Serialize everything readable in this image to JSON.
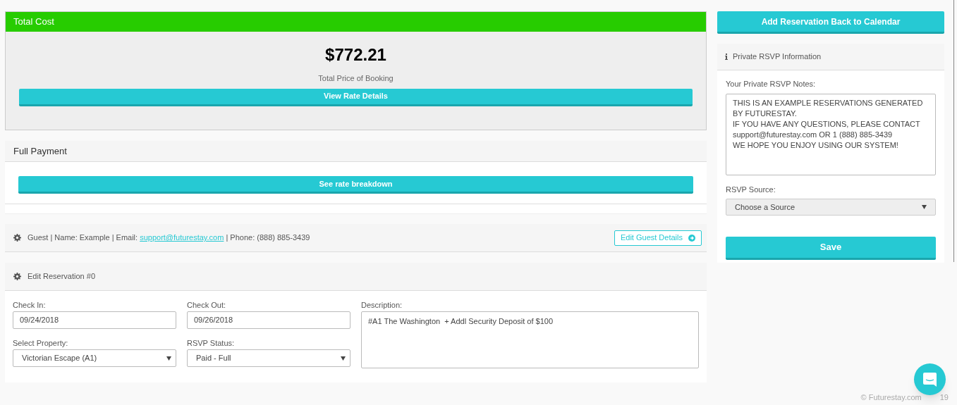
{
  "total_cost": {
    "title": "Total Cost",
    "amount": "$772.21",
    "caption": "Total Price of Booking",
    "button": "View Rate Details"
  },
  "payment": {
    "title": "Full Payment",
    "button": "See rate breakdown"
  },
  "guest": {
    "prefix": "Guest | Name: Example | Email:",
    "email": "support@futurestay.com",
    "suffix": "| Phone: (888) 885-3439",
    "button": "Edit Guest Details"
  },
  "reservation": {
    "title": "Edit Reservation #0",
    "fields": [
      {
        "kind": "input",
        "label": "Check In:",
        "value": "09/24/2018"
      },
      {
        "kind": "input",
        "label": "Check Out:",
        "value": "09/26/2018"
      },
      {
        "kind": "select",
        "label": "Select Property:",
        "value": "Victorian Escape (A1)"
      },
      {
        "kind": "select",
        "label": "RSVP Status:",
        "value": "Paid - Full"
      }
    ],
    "description": {
      "label": "Description:",
      "value": "#A1 The Washington  + Addl Security Deposit of $100"
    }
  },
  "sidebar": {
    "top_button": "Add Reservation Back to Calendar",
    "panel_title": "Private RSVP Information",
    "notes_label": "Your Private RSVP Notes:",
    "notes": [
      "THIS IS AN EXAMPLE RESERVATIONS GENERATED BY FUTURESTAY.",
      "IF YOU HAVE ANY QUESTIONS, PLEASE CONTACT support@futurestay.com OR 1 (888) 885-3439",
      "WE HOPE YOU ENJOY USING OUR SYSTEM!"
    ],
    "source_label": "RSVP Source:",
    "source_value": "Choose a Source",
    "save": "Save"
  },
  "footer": [
    "© Futurestay.com",
    "19"
  ]
}
